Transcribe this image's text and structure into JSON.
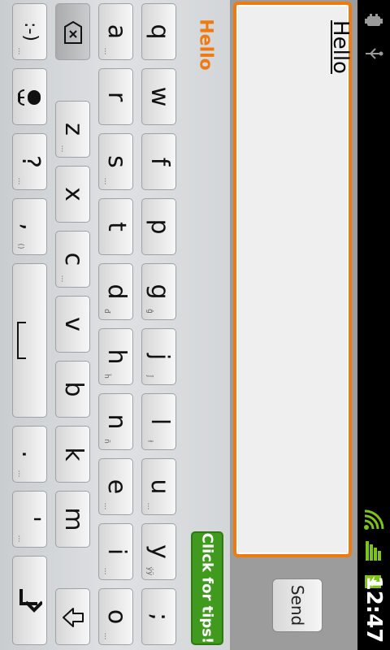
{
  "status_bar": {
    "time": "12:47",
    "icons": [
      "android-debug-icon",
      "usb-icon",
      "wifi-icon",
      "signal-icon",
      "battery-charging-icon"
    ]
  },
  "compose": {
    "message_text": "Hello",
    "send_label": "Send",
    "accent_color": "#f07a10"
  },
  "keyboard": {
    "suggestion": "Hello",
    "tips_label": "Click for tips!",
    "rows": {
      "row1": [
        {
          "label": "q",
          "sub": ""
        },
        {
          "label": "w",
          "sub": ""
        },
        {
          "label": "f",
          "sub": ""
        },
        {
          "label": "p",
          "sub": ""
        },
        {
          "label": "g",
          "sub": "ĝ"
        },
        {
          "label": "j",
          "sub": "ĵ"
        },
        {
          "label": "l",
          "sub": "ł"
        },
        {
          "label": "u",
          "sub": "…"
        },
        {
          "label": "y",
          "sub": "ýÿ"
        },
        {
          "label": ";",
          "sub": ""
        }
      ],
      "row2": [
        {
          "label": "a",
          "sub": "…"
        },
        {
          "label": "r",
          "sub": ""
        },
        {
          "label": "s",
          "sub": "…"
        },
        {
          "label": "t",
          "sub": ""
        },
        {
          "label": "d",
          "sub": "đ"
        },
        {
          "label": "h",
          "sub": "ĥ"
        },
        {
          "label": "n",
          "sub": "ñ"
        },
        {
          "label": "e",
          "sub": "…"
        },
        {
          "label": "i",
          "sub": "…"
        },
        {
          "label": "o",
          "sub": "…"
        }
      ],
      "row3": [
        {
          "label": "z",
          "sub": "…"
        },
        {
          "label": "x",
          "sub": ""
        },
        {
          "label": "c",
          "sub": "…"
        },
        {
          "label": "v",
          "sub": ""
        },
        {
          "label": "b",
          "sub": ""
        },
        {
          "label": "k",
          "sub": ""
        },
        {
          "label": "m",
          "sub": ""
        }
      ],
      "row4": {
        "emoticon": ":-)",
        "question": "?",
        "comma": ",",
        "comma_sub": "()",
        "period": ".",
        "apostrophe": "'"
      }
    }
  }
}
